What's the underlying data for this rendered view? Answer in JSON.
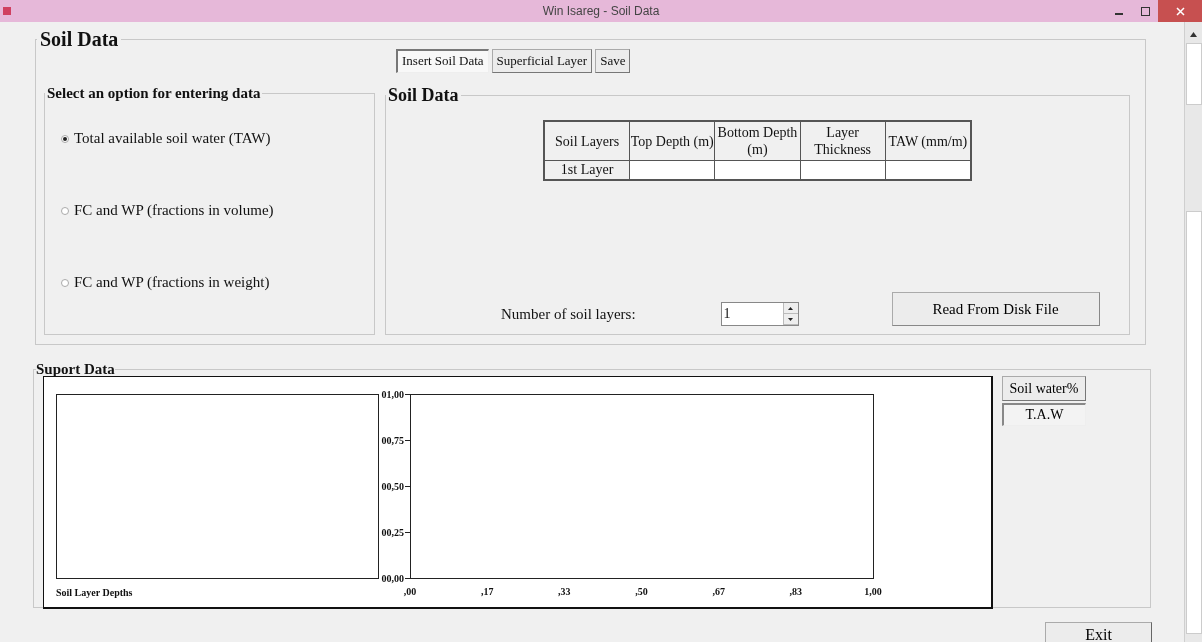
{
  "window": {
    "title": "Win Isareg - Soil Data"
  },
  "soil_data": {
    "title": "Soil Data",
    "tabs": [
      {
        "label": "Insert Soil Data",
        "selected": true
      },
      {
        "label": "Superficial Layer",
        "selected": false
      },
      {
        "label": "Save",
        "selected": false
      }
    ],
    "options": {
      "title": "Select an option for entering data",
      "items": [
        {
          "label": "Total available soil water (TAW)",
          "selected": true
        },
        {
          "label": "FC and WP (fractions in volume)",
          "selected": false
        },
        {
          "label": "FC and WP (fractions in weight)",
          "selected": false
        }
      ]
    },
    "table_panel": {
      "title": "Soil Data",
      "columns": [
        "Soil Layers",
        "Top Depth (m)",
        "Bottom Depth (m)",
        "Layer Thickness",
        "TAW (mm/m)"
      ],
      "rows": [
        [
          "1st  Layer",
          "",
          "",
          "",
          ""
        ]
      ],
      "layers_label": "Number of soil layers:",
      "layers_value": "1",
      "read_button": "Read From Disk File"
    }
  },
  "support_data": {
    "title": "Suport Data",
    "depth_label": "Soil Layer Depths",
    "chart_data": {
      "type": "line",
      "ylim": [
        0,
        1
      ],
      "categories": [
        ",00",
        ",17",
        ",33",
        ",50",
        ",67",
        ",83",
        "1,00"
      ],
      "yticks": [
        {
          "value": 0,
          "label": "00,00"
        },
        {
          "value": 0.25,
          "label": "00,25"
        },
        {
          "value": 0.5,
          "label": "00,50"
        },
        {
          "value": 0.75,
          "label": "00,75"
        },
        {
          "value": 1,
          "label": "01,00"
        }
      ]
    },
    "buttons": [
      {
        "label": "Soil water%",
        "selected": false
      },
      {
        "label": "T.A.W",
        "selected": true
      }
    ]
  },
  "exit_button": "Exit"
}
